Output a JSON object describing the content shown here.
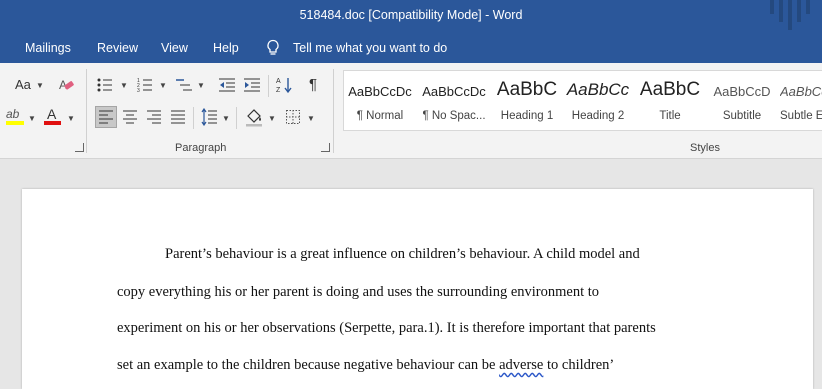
{
  "window": {
    "title": "518484.doc [Compatibility Mode]  -  Word"
  },
  "menu": {
    "tabs": [
      "Mailings",
      "Review",
      "View",
      "Help"
    ],
    "tell_me": "Tell me what you want to do"
  },
  "ribbon": {
    "font_group": {
      "change_case_label": "Aa"
    },
    "paragraph_group_label": "Paragraph",
    "styles_group_label": "Styles",
    "styles": [
      {
        "sample": "AaBbCcDc",
        "name": "¶ Normal"
      },
      {
        "sample": "AaBbCcDc",
        "name": "¶ No Spac..."
      },
      {
        "sample": "AaBbC",
        "name": "Heading 1"
      },
      {
        "sample": "AaBbCc",
        "name": "Heading 2"
      },
      {
        "sample": "AaBbC",
        "name": "Title"
      },
      {
        "sample": "AaBbCcD",
        "name": "Subtitle"
      },
      {
        "sample": "AaBbCcDc",
        "name": "Subtle E"
      }
    ],
    "colors": {
      "highlight": "#ffff00",
      "font_color": "#e01010"
    }
  },
  "document": {
    "lines": {
      "l1": "Parent’s behaviour is a great influence on children’s behaviour. A child model and",
      "l2": "copy everything his or her parent is doing and uses the surrounding environment to",
      "l3": "experiment on his or her observations (Serpette, para.1). It is therefore important that parents",
      "l4a": "set an example to the children because negative behaviour can be ",
      "l4b": "adverse",
      "l4c": " to children’"
    }
  },
  "colors": {
    "accent": "#2b579a"
  }
}
